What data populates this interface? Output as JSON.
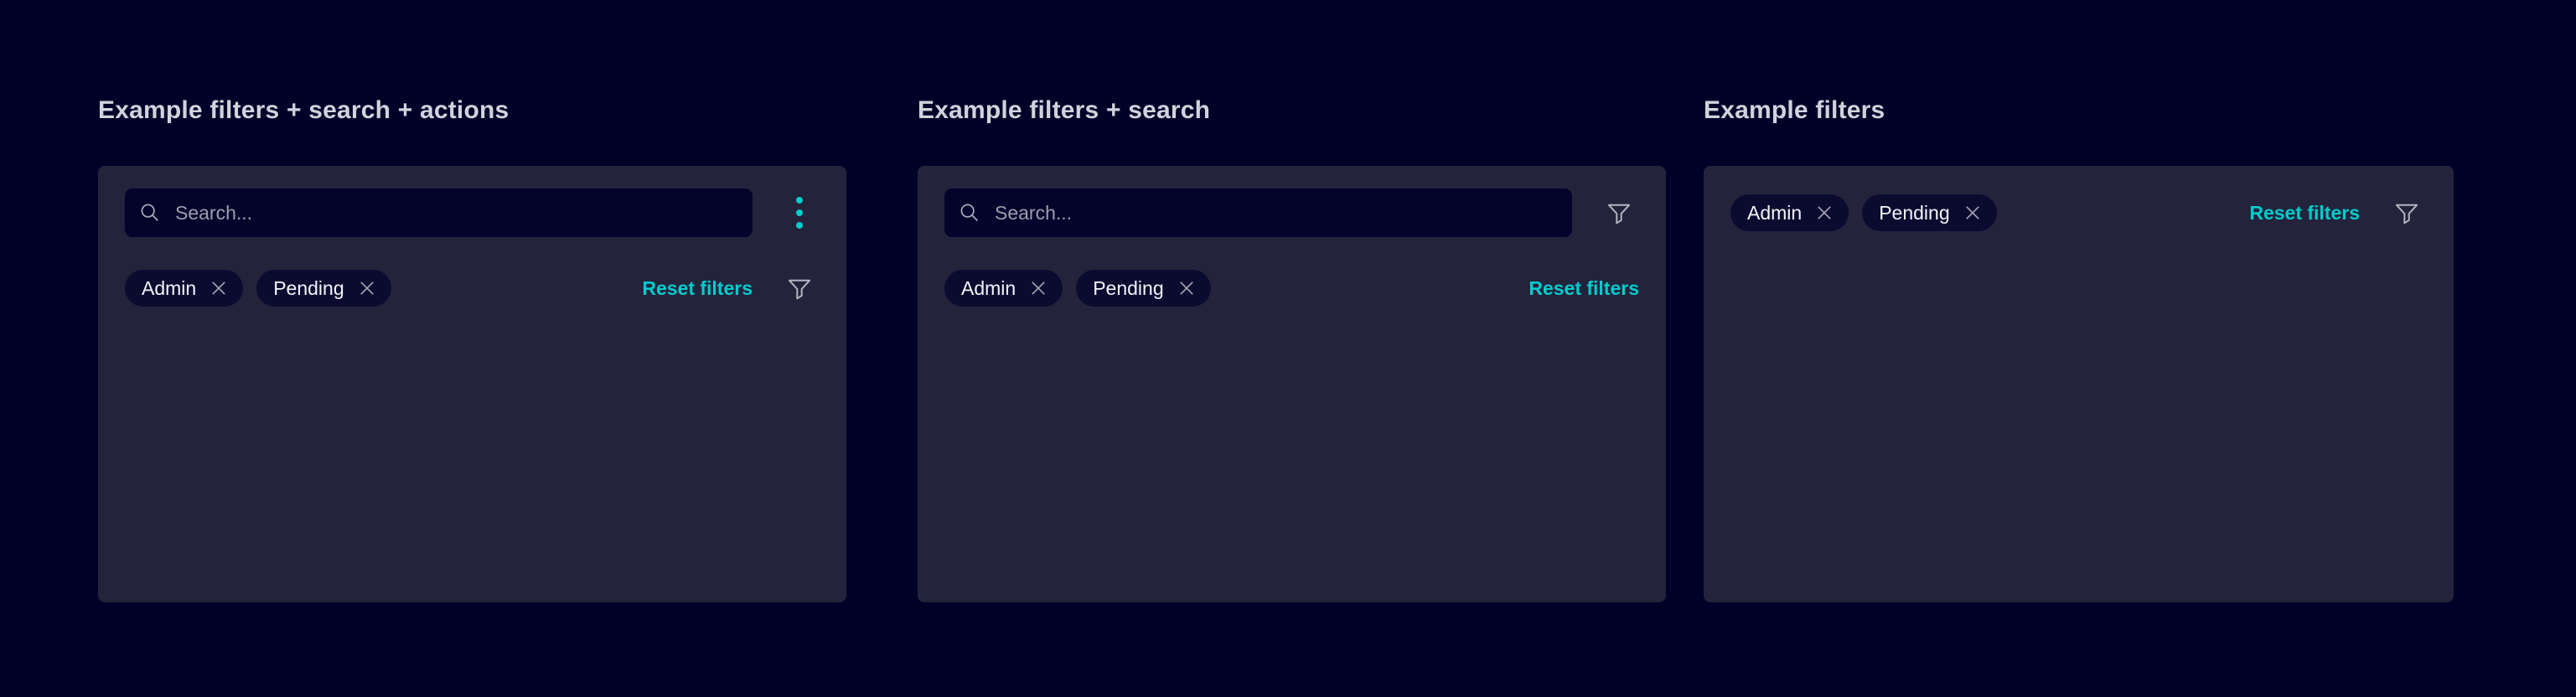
{
  "colors": {
    "page_bg": "#000028",
    "panel_bg": "#23233c",
    "field_bg": "#03032b",
    "chip_bg": "#0b0b30",
    "accent_teal": "#00cccc",
    "title_text": "#d2d2dc",
    "chip_text": "#f4f4f8",
    "muted_gray": "#9d9dad",
    "icon_gray": "#b5b5c0"
  },
  "icons": {
    "search": "search-icon (magnifier)",
    "kebab": "kebab-menu-icon (3 vertical teal dots)",
    "close": "close-x-icon",
    "funnel": "filter-funnel-icon"
  },
  "panels": [
    {
      "title": "Example filters + search + actions",
      "search": {
        "placeholder": "Search..."
      },
      "chips": [
        {
          "label": "Admin"
        },
        {
          "label": "Pending"
        }
      ],
      "reset_label": "Reset filters"
    },
    {
      "title": "Example filters + search",
      "search": {
        "placeholder": "Search..."
      },
      "chips": [
        {
          "label": "Admin"
        },
        {
          "label": "Pending"
        }
      ],
      "reset_label": "Reset filters"
    },
    {
      "title": "Example filters",
      "chips": [
        {
          "label": "Admin"
        },
        {
          "label": "Pending"
        }
      ],
      "reset_label": "Reset filters"
    }
  ]
}
